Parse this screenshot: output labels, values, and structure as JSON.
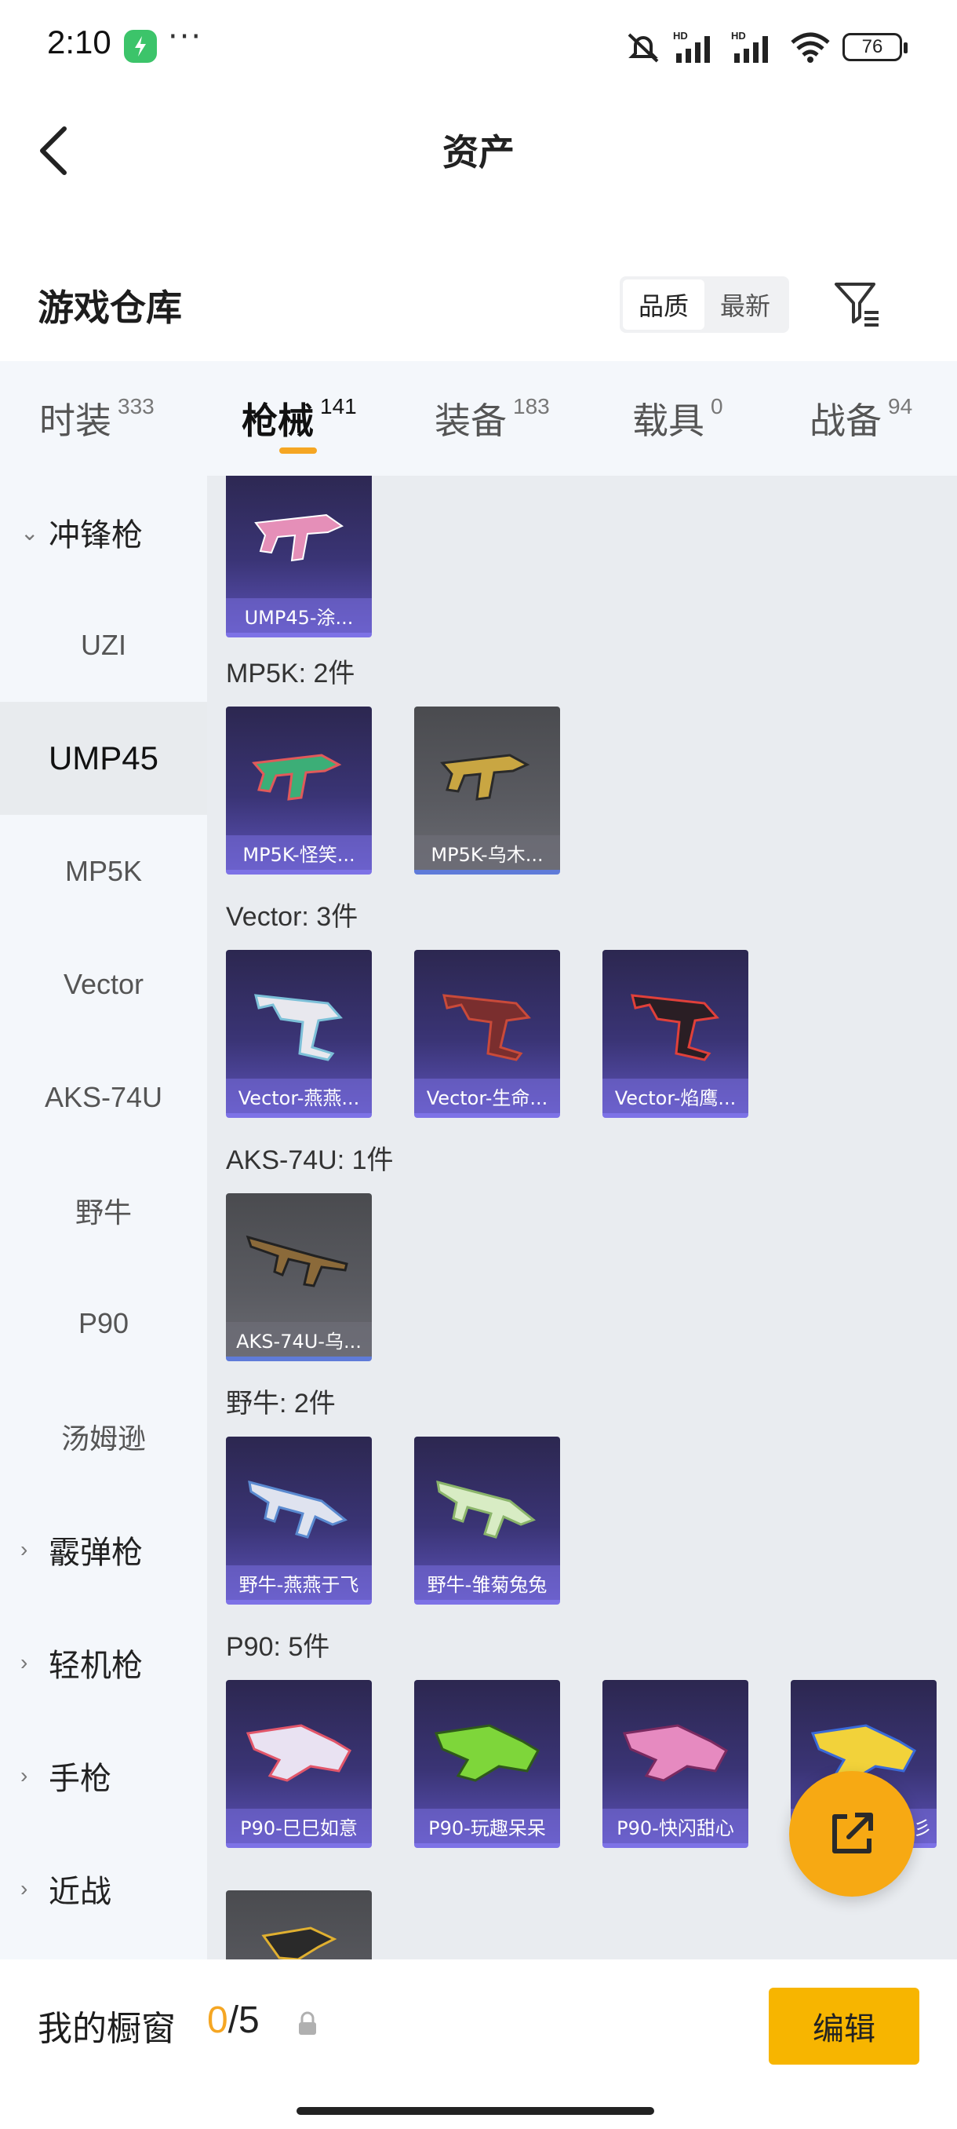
{
  "status_bar": {
    "time": "2:10",
    "dots": "···",
    "battery": "76"
  },
  "header": {
    "title": "资产"
  },
  "warehouse": {
    "title": "游戏仓库",
    "sort_options": [
      "品质",
      "最新"
    ],
    "sort_selected": "品质"
  },
  "tabs": [
    {
      "label": "时装",
      "count": "333"
    },
    {
      "label": "枪械",
      "count": "141"
    },
    {
      "label": "装备",
      "count": "183"
    },
    {
      "label": "载具",
      "count": "0"
    },
    {
      "label": "战备",
      "count": "94"
    }
  ],
  "active_tab": "枪械",
  "sidebar": {
    "items": [
      {
        "label": "冲锋枪",
        "type": "group",
        "expanded": true
      },
      {
        "label": "UZI"
      },
      {
        "label": "UMP45",
        "selected": true
      },
      {
        "label": "MP5K"
      },
      {
        "label": "Vector"
      },
      {
        "label": "AKS-74U"
      },
      {
        "label": "野牛"
      },
      {
        "label": "P90"
      },
      {
        "label": "汤姆逊"
      },
      {
        "label": "霰弹枪",
        "type": "group"
      },
      {
        "label": "轻机枪",
        "type": "group"
      },
      {
        "label": "手枪",
        "type": "group"
      },
      {
        "label": "近战",
        "type": "group"
      }
    ]
  },
  "content": {
    "top_card": "UMP45-涂...",
    "groups": [
      {
        "label": "MP5K: 2件",
        "items": [
          "MP5K-怪笑...",
          "MP5K-乌木..."
        ]
      },
      {
        "label": "Vector: 3件",
        "items": [
          "Vector-燕燕...",
          "Vector-生命...",
          "Vector-焰鹰..."
        ]
      },
      {
        "label": "AKS-74U: 1件",
        "items": [
          "AKS-74U-乌..."
        ]
      },
      {
        "label": "野牛: 2件",
        "items": [
          "野牛-燕燕于飞",
          "野牛-雏菊兔兔"
        ]
      },
      {
        "label": "P90: 5件",
        "items": [
          "P90-巳巳如意",
          "P90-玩趣呆呆",
          "P90-快闪甜心",
          "彡"
        ]
      }
    ]
  },
  "bottom_bar": {
    "showcase_label": "我的橱窗",
    "current": "0",
    "total": "/5",
    "edit_label": "编辑"
  },
  "colors": {
    "accent": "#f5a623",
    "edit_button": "#f7b500",
    "card_purple": "#3a3475",
    "card_gray": "#5a5b61"
  }
}
